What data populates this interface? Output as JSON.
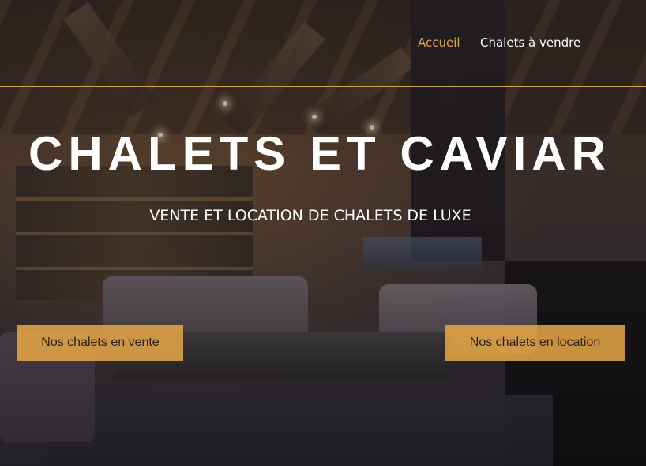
{
  "nav": {
    "items": [
      {
        "label": "Accueil",
        "active": true
      },
      {
        "label": "Chalets à vendre",
        "active": false
      }
    ],
    "accent_color": "#e0a44c"
  },
  "hero": {
    "title": "CHALETS ET CAVIAR",
    "subtitle": "VENTE ET LOCATION DE CHALETS DE LUXE",
    "buttons": {
      "sale_label": "Nos chalets en vente",
      "rent_label": "Nos chalets en location"
    },
    "button_color": "#e8a848"
  }
}
